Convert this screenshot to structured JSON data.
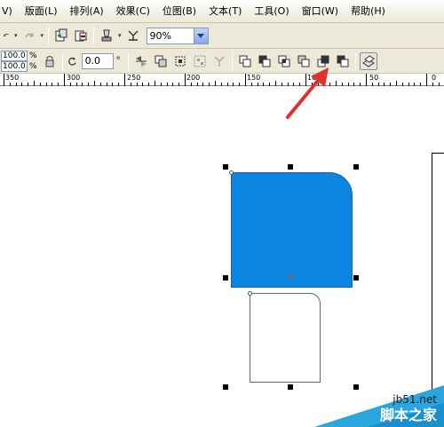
{
  "menu": {
    "items": [
      {
        "label": "V)"
      },
      {
        "label": "版面(L)"
      },
      {
        "label": "排列(A)"
      },
      {
        "label": "效果(C)"
      },
      {
        "label": "位图(B)"
      },
      {
        "label": "文本(T)"
      },
      {
        "label": "工具(O)"
      },
      {
        "label": "窗口(W)"
      },
      {
        "label": "帮助(H)"
      }
    ]
  },
  "toolbar": {
    "zoom_value": "90%"
  },
  "property_bar": {
    "scale_x": "100.0",
    "scale_y": "100.0",
    "pct_x": "%",
    "pct_y": "%",
    "rotation_value": "0.0",
    "rotation_unit": "°"
  },
  "ruler": {
    "labels": [
      "350",
      "300",
      "250",
      "200",
      "150",
      "100",
      "50",
      "0"
    ]
  },
  "canvas": {
    "center_mark": "×"
  },
  "watermark": {
    "url": "jb51.net",
    "brand": "脚本之家"
  },
  "colors": {
    "shape_fill": "#0a86e0",
    "arrow": "#e03030",
    "toolbar_bg": "#ece9d8"
  }
}
